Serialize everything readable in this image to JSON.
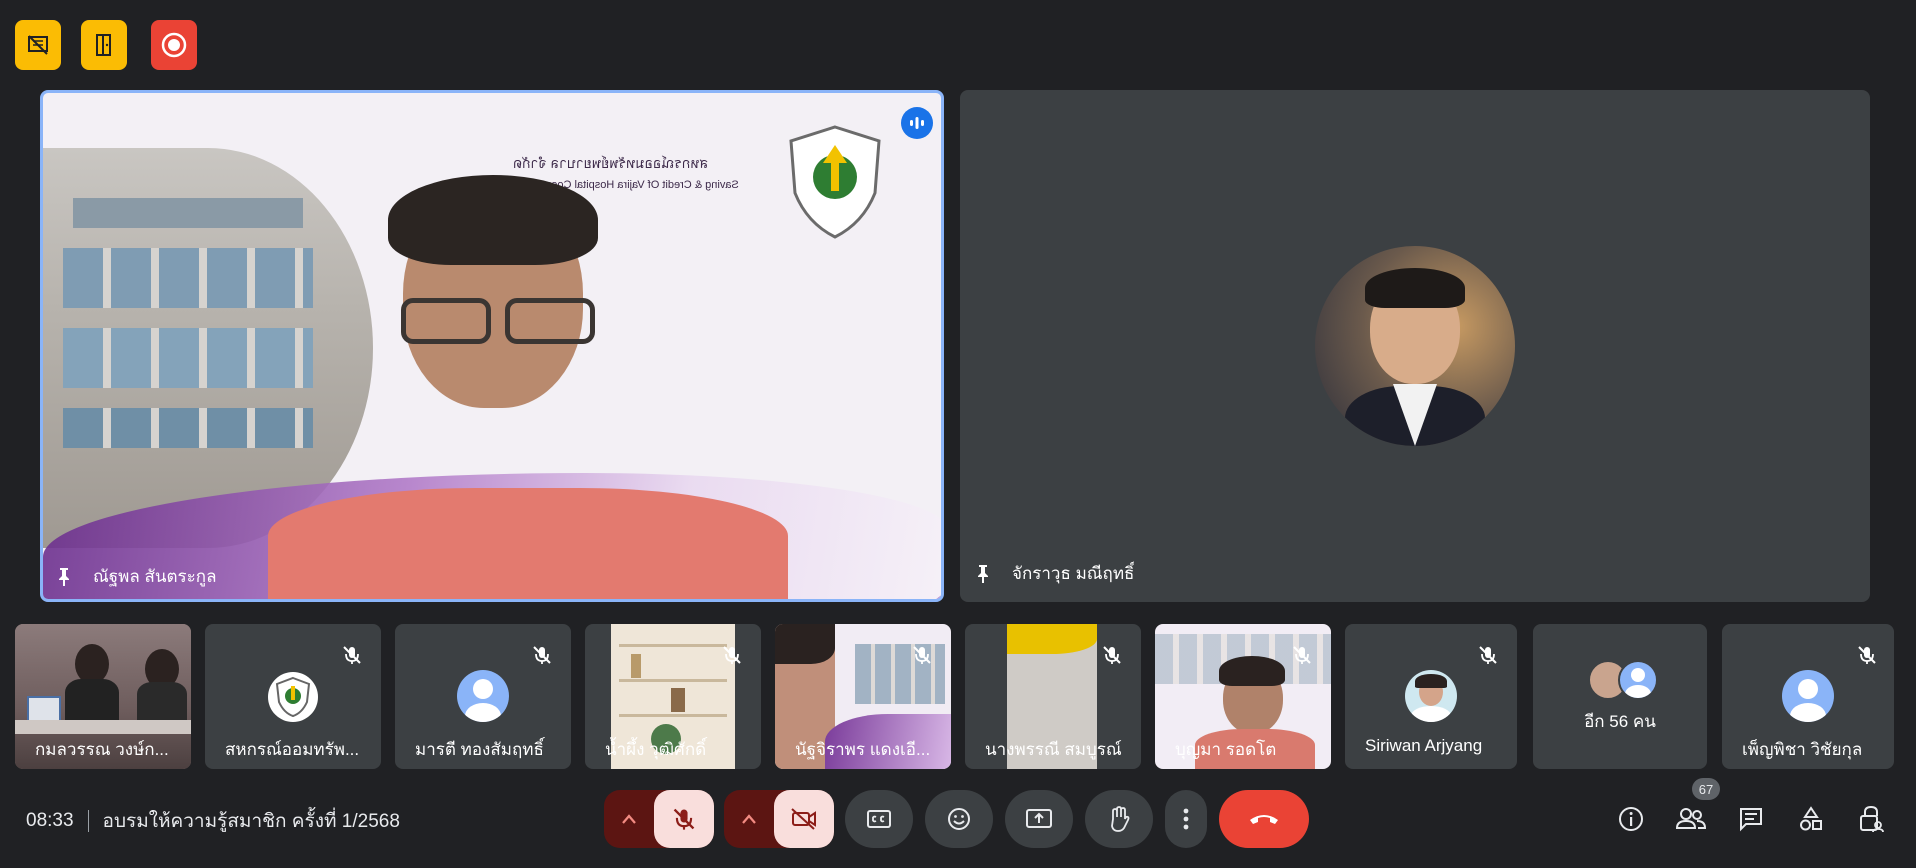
{
  "top_toolbar": {
    "buttons": [
      {
        "icon": "no-presenting-icon",
        "color": "#fbbc04"
      },
      {
        "icon": "door-icon",
        "color": "#fbbc04"
      },
      {
        "icon": "record-icon",
        "color": "#ea4335"
      }
    ]
  },
  "main_tiles": [
    {
      "name": "ณัฐพล สันตระกูล",
      "speaking": true,
      "logo_text_1": "สหกรณ์ออมทรัพย์พยาบาล จำกัด",
      "logo_text_2": "Saving & Credit Of Vajira Hospital Coop., LTD."
    },
    {
      "name": "จักราวุธ มณีฤทธิ์",
      "speaking": false
    }
  ],
  "strip": [
    {
      "name": "กมลวรรณ วงษ์ก...",
      "muted": false
    },
    {
      "name": "สหกรณ์ออมทรัพ...",
      "muted": true
    },
    {
      "name": "มารตี ทองสัมฤทธิ์",
      "muted": true
    },
    {
      "name": "น้ำผึ้ง วุฒิศักดิ์",
      "muted": true
    },
    {
      "name": "นัฐจิราพร แดงเอี...",
      "muted": true
    },
    {
      "name": "นางพรรณี สมบูรณ์",
      "muted": true
    },
    {
      "name": "บุญมา รอดโต",
      "muted": true
    },
    {
      "name": "Siriwan Arjyang",
      "muted": true
    },
    {
      "name": "อีก 56 คน",
      "muted": false
    },
    {
      "name": "เพ็ญพิชา วิชัยกุล",
      "muted": true
    }
  ],
  "bottom_bar": {
    "time": "08:33",
    "meeting_title": "อบรมให้ความรู้สมาชิก ครั้งที่ 1/2568",
    "participant_count": "67",
    "accent_danger": "#ea4335",
    "accent_muted": "#8c1d18"
  }
}
